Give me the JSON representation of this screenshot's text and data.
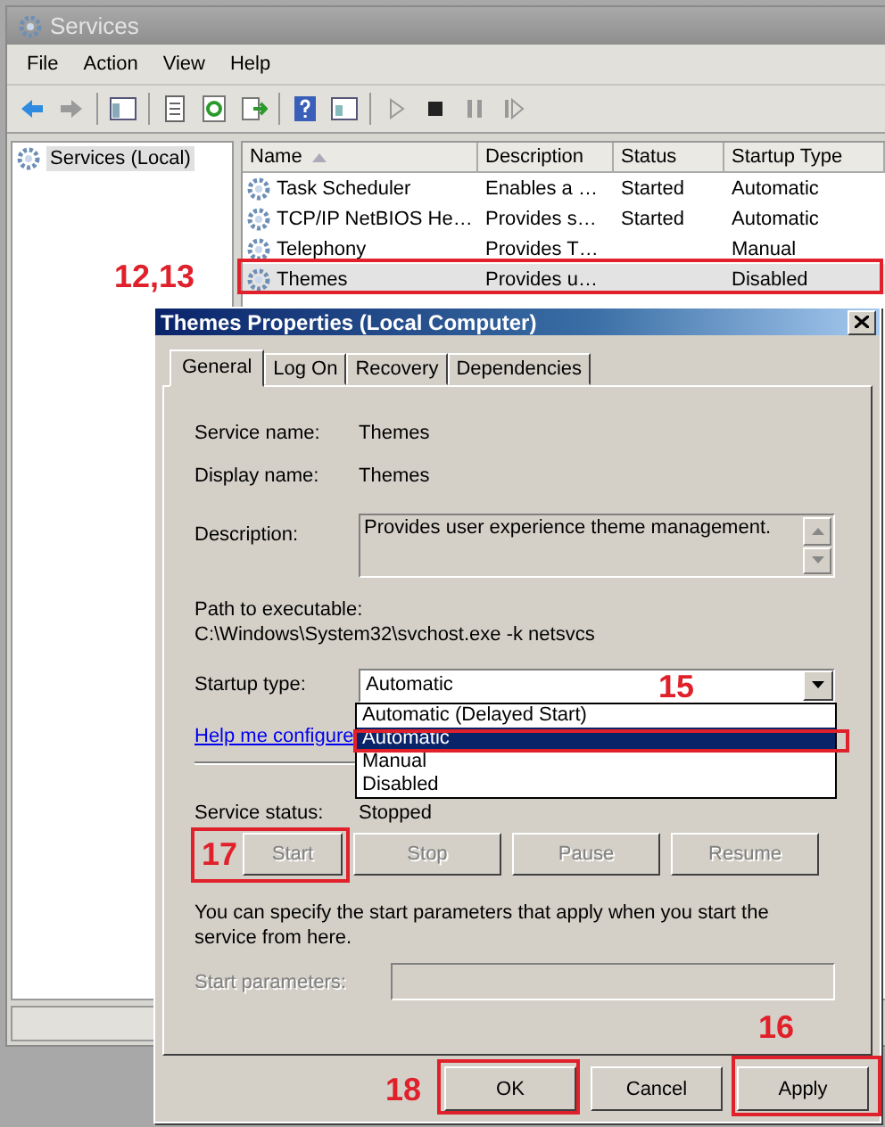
{
  "services_window": {
    "title": "Services",
    "menu": [
      "File",
      "Action",
      "View",
      "Help"
    ],
    "tree_item": "Services (Local)",
    "columns": [
      "Name",
      "Description",
      "Status",
      "Startup Type"
    ],
    "rows": [
      {
        "name": "Task Scheduler",
        "description": "Enables a …",
        "status": "Started",
        "startup_type": "Automatic",
        "selected": false
      },
      {
        "name": "TCP/IP NetBIOS He…",
        "description": "Provides s…",
        "status": "Started",
        "startup_type": "Automatic",
        "selected": false
      },
      {
        "name": "Telephony",
        "description": "Provides T…",
        "status": "",
        "startup_type": "Manual",
        "selected": false
      },
      {
        "name": "Themes",
        "description": "Provides u…",
        "status": "",
        "startup_type": "Disabled",
        "selected": true
      }
    ]
  },
  "dialog": {
    "title": "Themes Properties (Local Computer)",
    "tabs": [
      {
        "label": "General",
        "selected": true
      },
      {
        "label": "Log On",
        "selected": false
      },
      {
        "label": "Recovery",
        "selected": false
      },
      {
        "label": "Dependencies",
        "selected": false
      }
    ],
    "service_name": {
      "label": "Service name:",
      "value": "Themes"
    },
    "display_name": {
      "label": "Display name:",
      "value": "Themes"
    },
    "description": {
      "label": "Description:",
      "value": "Provides user experience theme management."
    },
    "path": {
      "label": "Path to executable:",
      "value": "C:\\Windows\\System32\\svchost.exe -k netsvcs"
    },
    "startup_type": {
      "label": "Startup type:",
      "value": "Automatic",
      "options": [
        {
          "label": "Automatic (Delayed Start)",
          "selected": false
        },
        {
          "label": "Automatic",
          "selected": true
        },
        {
          "label": "Manual",
          "selected": false
        },
        {
          "label": "Disabled",
          "selected": false
        }
      ]
    },
    "help_link": "Help me configure",
    "service_status": {
      "label": "Service status:",
      "value": "Stopped"
    },
    "control_buttons": [
      {
        "label": "Start",
        "disabled": true
      },
      {
        "label": "Stop",
        "disabled": true
      },
      {
        "label": "Pause",
        "disabled": true
      },
      {
        "label": "Resume",
        "disabled": true
      }
    ],
    "note": "You can specify the start parameters that apply when you start the service from here.",
    "start_parameters": {
      "label": "Start parameters:",
      "disabled": true
    },
    "footer_buttons": [
      "OK",
      "Cancel",
      "Apply"
    ]
  },
  "annotations": [
    {
      "text": "12,13"
    },
    {
      "text": "15"
    },
    {
      "text": "17"
    },
    {
      "text": "16"
    },
    {
      "text": "18"
    }
  ]
}
